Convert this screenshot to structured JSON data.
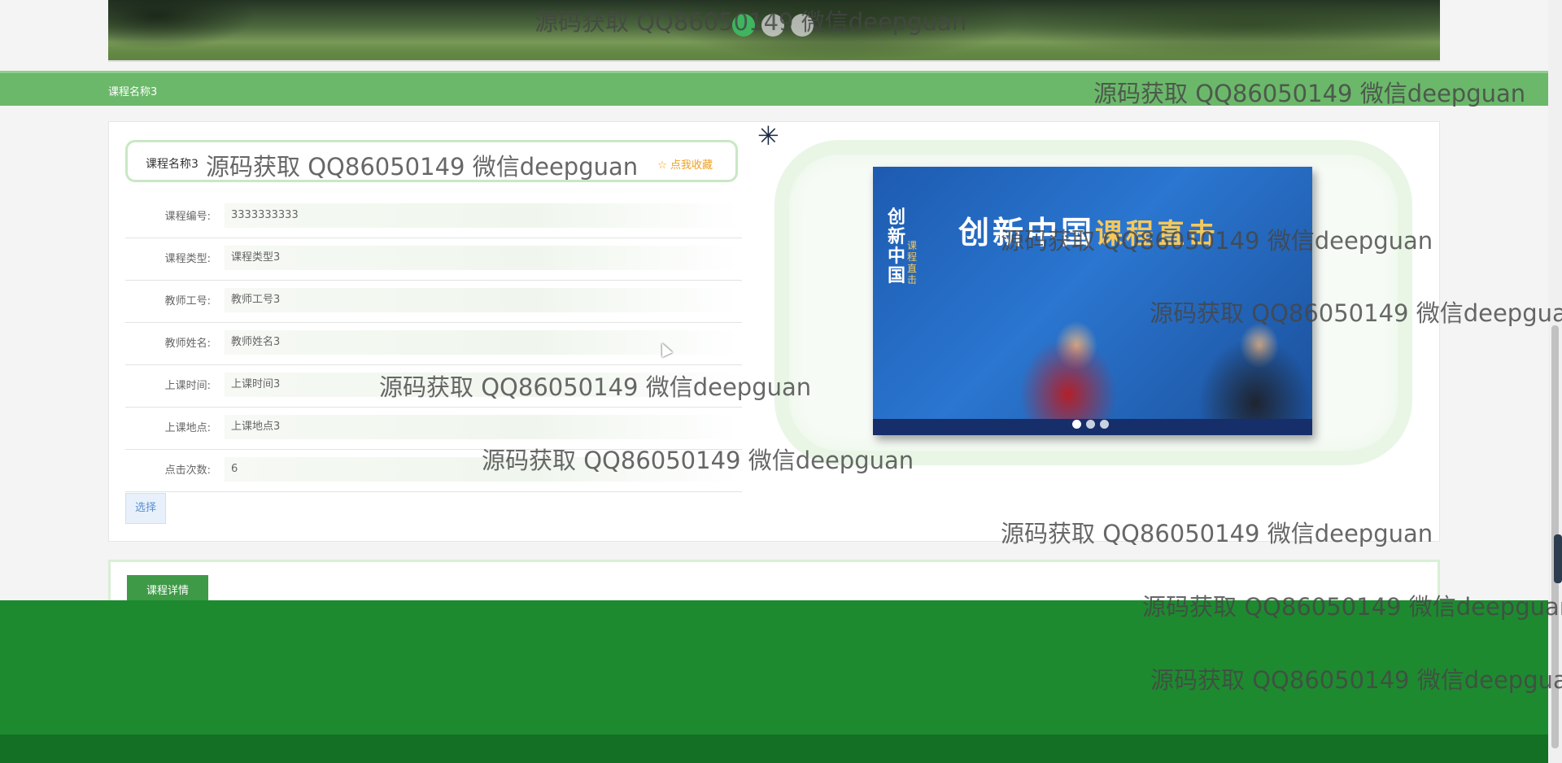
{
  "banner": {
    "dots": 3,
    "active_dot": 0
  },
  "breadcrumb": {
    "current": "课程名称3"
  },
  "course": {
    "name": "课程名称3",
    "favorite_label": "☆ 点我收藏",
    "fields": [
      {
        "label": "课程编号:",
        "value": "3333333333"
      },
      {
        "label": "课程类型:",
        "value": "课程类型3"
      },
      {
        "label": "教师工号:",
        "value": "教师工号3"
      },
      {
        "label": "教师姓名:",
        "value": "教师姓名3"
      },
      {
        "label": "上课时间:",
        "value": "上课时间3"
      },
      {
        "label": "上课地点:",
        "value": "上课地点3"
      },
      {
        "label": "点击次数:",
        "value": "6"
      }
    ],
    "select_label": "选择"
  },
  "book_cover": {
    "spine_title": "创新中国",
    "spine_sub": "课程直击",
    "title_main": "创新中国",
    "title_accent": "课程直击"
  },
  "tabs": {
    "detail_label": "课程详情"
  },
  "watermark": "源码获取 QQ86050149 微信deepguan"
}
